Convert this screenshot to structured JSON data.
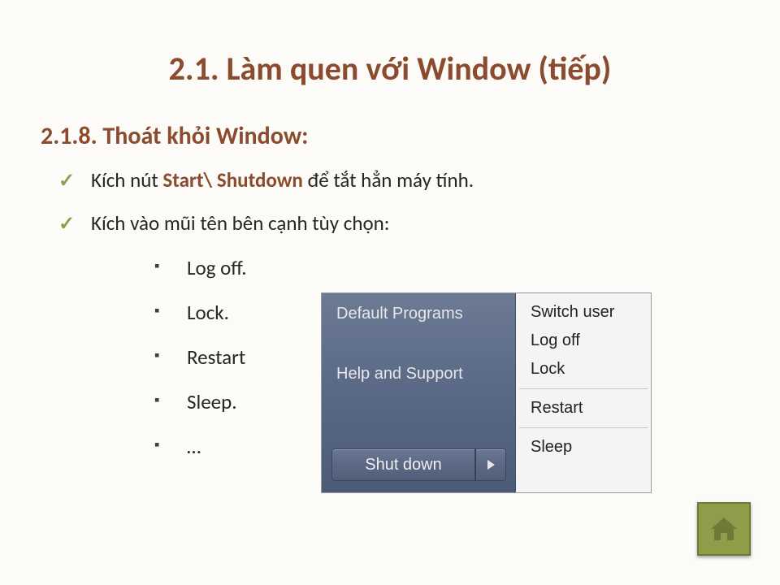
{
  "title": "2.1. Làm quen với Window (tiếp)",
  "subtitle": "2.1.8. Thoát khỏi Window:",
  "bullet1_pre": "Kích nút ",
  "bullet1_bold": "Start\\ Shutdown",
  "bullet1_post": " để tắt hẳn máy tính.",
  "bullet2": "Kích vào mũi tên bên cạnh tùy chọn:",
  "sub": {
    "a": "Log off.",
    "b": "Lock.",
    "c": "Restart",
    "d": "Sleep.",
    "e": "…"
  },
  "win": {
    "default_programs": "Default Programs",
    "help_support": "Help and Support",
    "shut_down": "Shut down",
    "menu": {
      "switch_user": "Switch user",
      "log_off": "Log off",
      "lock": "Lock",
      "restart": "Restart",
      "sleep": "Sleep"
    }
  }
}
